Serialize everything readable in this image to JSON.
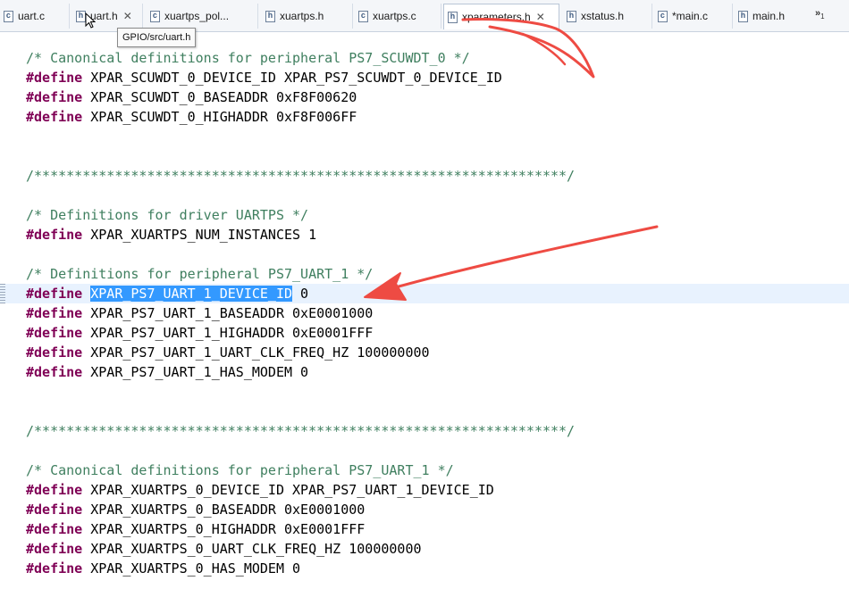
{
  "tabs": [
    {
      "label": "uart.c",
      "icon": "c",
      "closable": false
    },
    {
      "label": "uart.h",
      "icon": "h",
      "closable": true
    },
    {
      "label": "xuartps_pol...",
      "icon": "c",
      "closable": false
    },
    {
      "label": "xuartps.h",
      "icon": "h",
      "closable": false
    },
    {
      "label": "xuartps.c",
      "icon": "c",
      "closable": false
    },
    {
      "label": "xparameters.h",
      "icon": "h",
      "closable": true,
      "active": true
    },
    {
      "label": "xstatus.h",
      "icon": "h",
      "closable": false
    },
    {
      "label": "*main.c",
      "icon": "c",
      "closable": false
    },
    {
      "label": "main.h",
      "icon": "h",
      "closable": false
    }
  ],
  "overflow": {
    "symbol": "»",
    "count": "1"
  },
  "close_glyph": "✕",
  "tooltip": "GPIO/src/uart.h",
  "code": {
    "define_kw": "#define",
    "l1": "/* Canonical definitions for peripheral PS7_SCUWDT_0 */",
    "l2": " XPAR_SCUWDT_0_DEVICE_ID XPAR_PS7_SCUWDT_0_DEVICE_ID",
    "l3": " XPAR_SCUWDT_0_BASEADDR 0xF8F00620",
    "l4": " XPAR_SCUWDT_0_HIGHADDR 0xF8F006FF",
    "sep1": "/******************************************************************/",
    "l5": "/* Definitions for driver UARTPS */",
    "l6": " XPAR_XUARTPS_NUM_INSTANCES 1",
    "l7": "/* Definitions for peripheral PS7_UART_1 */",
    "l8_selected": "XPAR_PS7_UART_1_DEVICE_ID",
    "l8_rest": " 0",
    "l9": " XPAR_PS7_UART_1_BASEADDR 0xE0001000",
    "l10": " XPAR_PS7_UART_1_HIGHADDR 0xE0001FFF",
    "l11": " XPAR_PS7_UART_1_UART_CLK_FREQ_HZ 100000000",
    "l12": " XPAR_PS7_UART_1_HAS_MODEM 0",
    "sep2": "/******************************************************************/",
    "l13": "/* Canonical definitions for peripheral PS7_UART_1 */",
    "l14": " XPAR_XUARTPS_0_DEVICE_ID XPAR_PS7_UART_1_DEVICE_ID",
    "l15": " XPAR_XUARTPS_0_BASEADDR 0xE0001000",
    "l16": " XPAR_XUARTPS_0_HIGHADDR 0xE0001FFF",
    "l17": " XPAR_XUARTPS_0_UART_CLK_FREQ_HZ 100000000",
    "l18": " XPAR_XUARTPS_0_HAS_MODEM 0"
  },
  "colors": {
    "keyword": "#7f0055",
    "comment": "#3f7f5f",
    "selection": "#3399ff",
    "annotation": "#ee4b43"
  }
}
